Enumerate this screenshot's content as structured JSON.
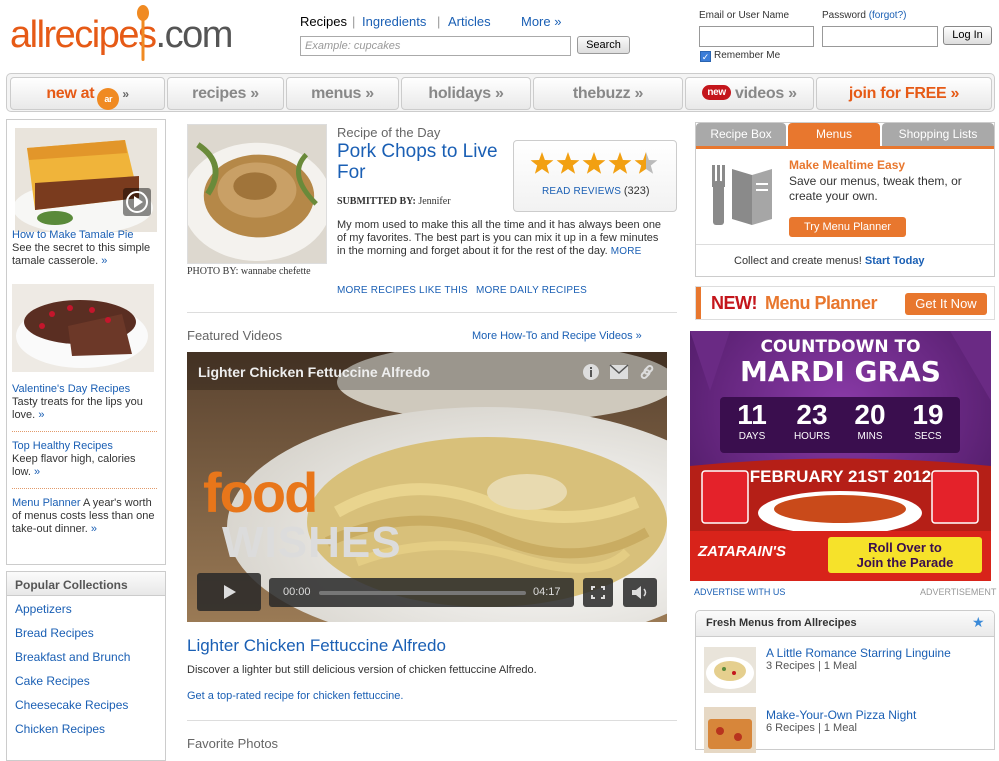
{
  "header": {
    "logo_text": "allrecipes.com",
    "search_tabs": [
      "Recipes",
      "Ingredients",
      "Articles",
      "More »"
    ],
    "search_placeholder": "Example: cupcakes",
    "search_button": "Search",
    "login": {
      "username_label": "Email or User Name",
      "password_label": "Password",
      "forgot": "(forgot?)",
      "login_button": "Log In",
      "remember": "Remember Me",
      "remember_checked": true
    }
  },
  "nav": {
    "items": [
      "new at",
      "recipes »",
      "menus »",
      "holidays »",
      "thebuzz »",
      "videos »",
      "join for FREE »"
    ],
    "new_badge": "new",
    "ar_badge": "ar"
  },
  "left": {
    "items": [
      {
        "title": "How to Make Tamale Pie",
        "text": "See the secret to this simple tamale casserole.",
        "more": "»"
      },
      {
        "title": "Valentine's Day Recipes",
        "text": "Tasty treats for the lips you love.",
        "more": "»"
      },
      {
        "title": "Top Healthy Recipes",
        "text": "Keep flavor high, calories low.",
        "more": "»"
      },
      {
        "title": "Menu Planner",
        "text": "A year's worth of menus costs less than one take-out dinner.",
        "more": "»"
      }
    ],
    "collections_title": "Popular Collections",
    "collections": [
      "Appetizers",
      "Bread Recipes",
      "Breakfast and Brunch",
      "Cake Recipes",
      "Cheesecake Recipes",
      "Chicken Recipes"
    ]
  },
  "rotd": {
    "label": "Recipe of the Day",
    "title": "Pork Chops to Live For",
    "submitted_label": "SUBMITTED BY:",
    "submitted_by": "Jennifer",
    "photo_label": "PHOTO BY:",
    "photo_by": "wannabe chefette",
    "rating": 4.5,
    "read_reviews": "READ REVIEWS",
    "review_count": "(323)",
    "description": "My mom used to make this all the time and it has always been one of my favorites. The best part is you can mix it up in a few minutes in the morning and forget about it for the rest of the day.",
    "more": "MORE",
    "more_like_this": "MORE RECIPES LIKE THIS",
    "more_daily": "MORE DAILY RECIPES"
  },
  "videos": {
    "heading": "Featured Videos",
    "more_link": "More How-To and Recipe Videos »",
    "player_title": "Lighter Chicken Fettuccine Alfredo",
    "brand_top": "food",
    "brand_bottom": "WISHES",
    "time_current": "00:00",
    "time_total": "04:17",
    "progress": 0,
    "title": "Lighter Chicken Fettuccine Alfredo",
    "description": "Discover a lighter but still delicious version of chicken fettuccine Alfredo.",
    "cta": "Get a top-rated recipe for chicken fettuccine.",
    "next_heading": "Favorite Photos"
  },
  "right": {
    "tabs": [
      "Recipe Box",
      "Menus",
      "Shopping Lists"
    ],
    "active_tab": "Menus",
    "tab_heading": "Make Mealtime Easy",
    "tab_text": "Save our menus, tweak them, or create your own.",
    "tab_button": "Try Menu Planner",
    "tab_footer": "Collect and create menus!",
    "tab_footer_link": "Start Today",
    "banner_new": "NEW!",
    "banner_title": "Menu Planner",
    "banner_button": "Get It Now",
    "ad": {
      "line1": "COUNTDOWN TO",
      "line2": "MARDI GRAS",
      "counts": [
        {
          "n": "11",
          "u": "DAYS"
        },
        {
          "n": "23",
          "u": "HOURS"
        },
        {
          "n": "20",
          "u": "MINS"
        },
        {
          "n": "19",
          "u": "SECS"
        }
      ],
      "date": "FEBRUARY 21ST 2012",
      "brand": "ZATARAIN'S",
      "cta1": "Roll Over to",
      "cta2": "Join the Parade"
    },
    "advertise": "ADVERTISE WITH US",
    "advertisement": "ADVERTISEMENT",
    "fresh_title": "Fresh Menus from Allrecipes",
    "fresh": [
      {
        "title": "A Little Romance Starring Linguine",
        "meta": "3 Recipes | 1 Meal"
      },
      {
        "title": "Make-Your-Own Pizza Night",
        "meta": "6 Recipes | 1 Meal"
      }
    ]
  },
  "colors": {
    "brand_orange": "#e65a16",
    "link_blue": "#1a5fb4",
    "tab_active": "#e8772e",
    "tab_inactive": "#aaaaaa"
  }
}
